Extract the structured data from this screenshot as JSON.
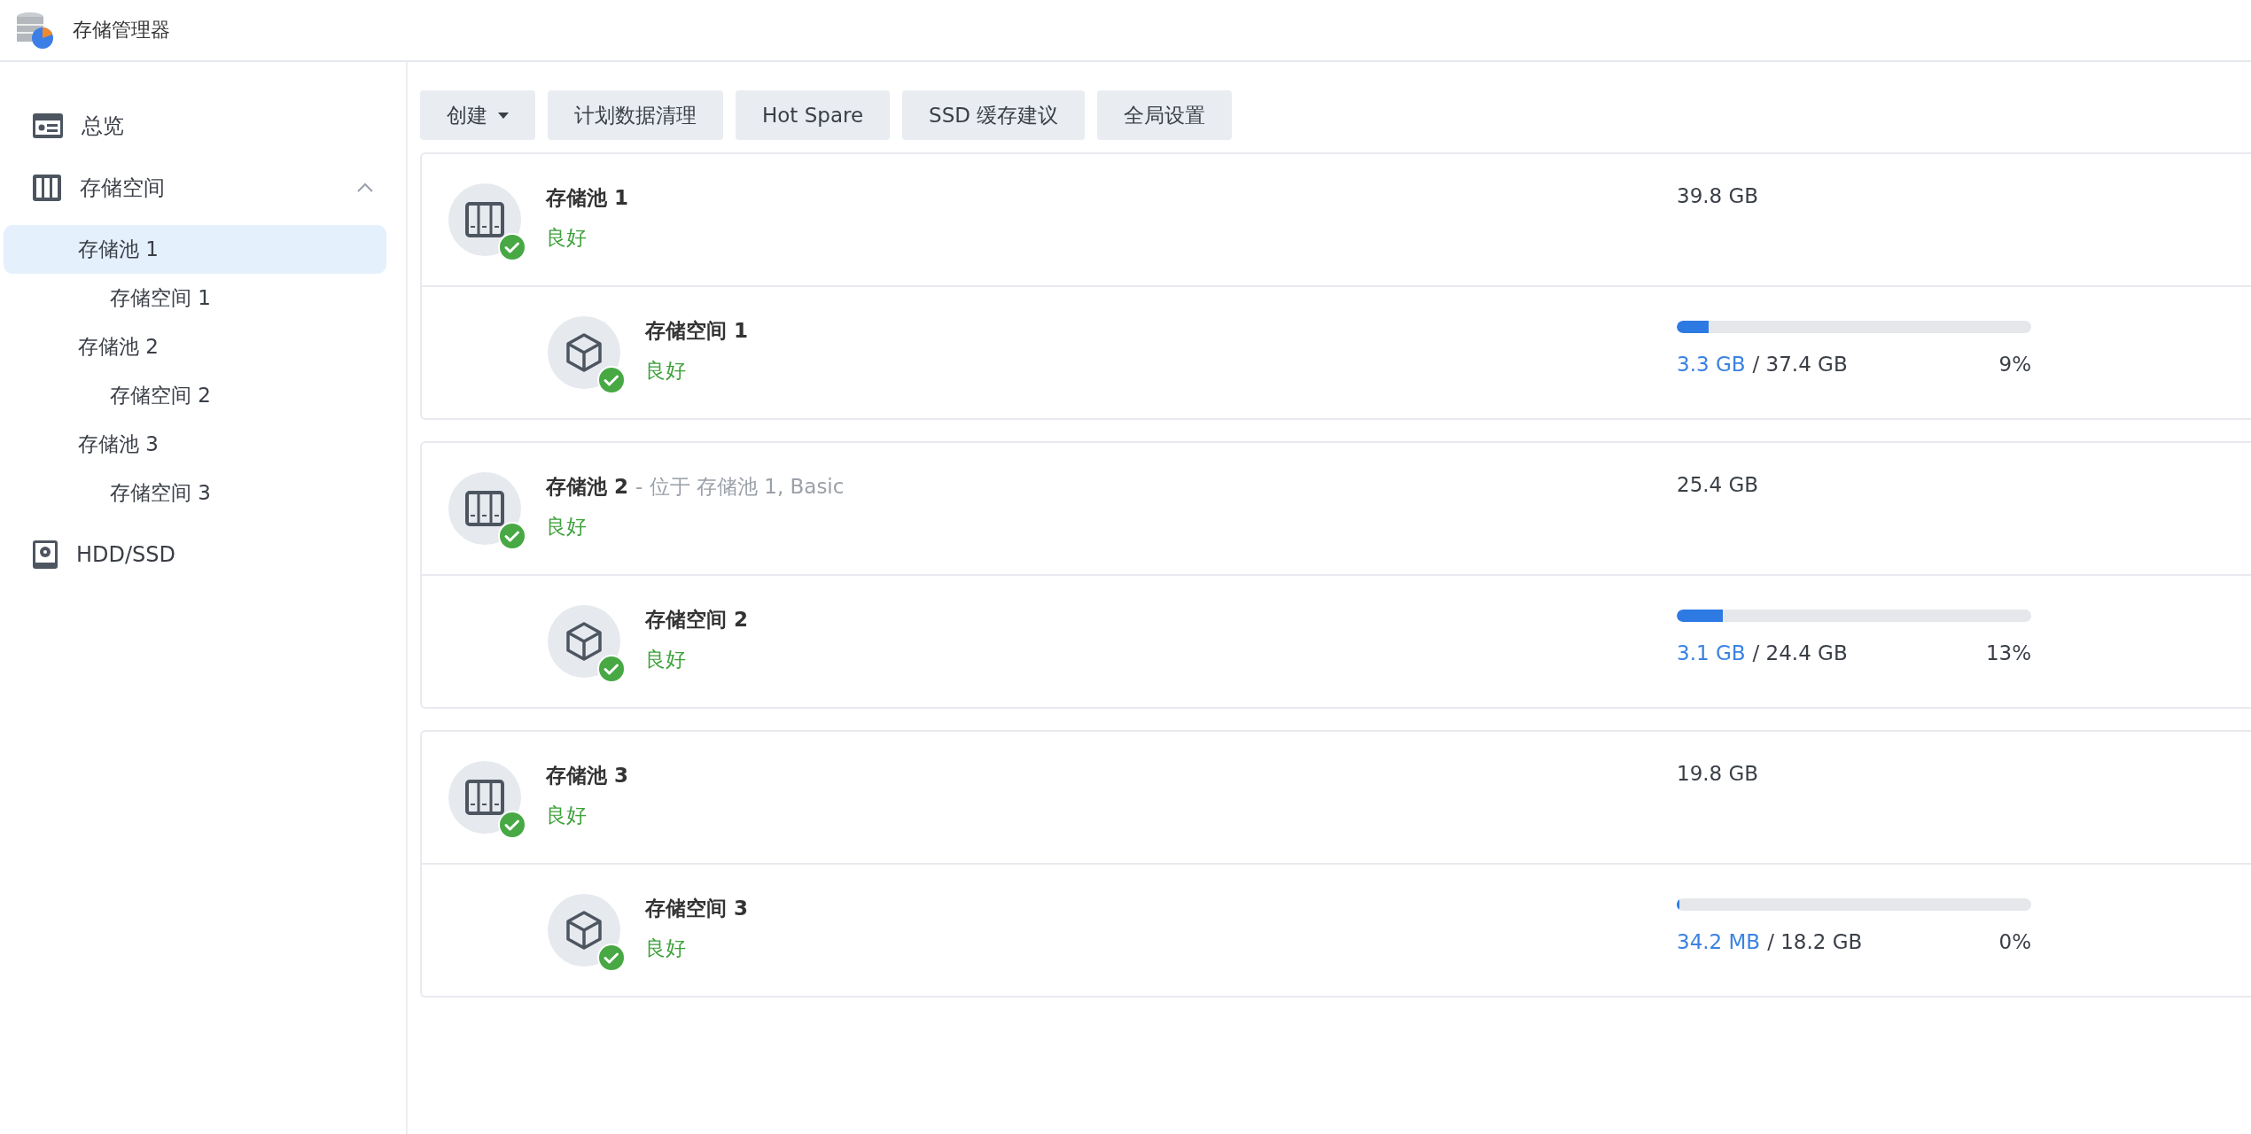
{
  "window": {
    "title": "存储管理器"
  },
  "sidebar": {
    "items": [
      {
        "label": "总览",
        "kind": "overview",
        "selected": false
      },
      {
        "label": "存储空间",
        "kind": "storage",
        "selected": false,
        "expanded": true,
        "children": [
          {
            "label": "存储池 1",
            "selected": true,
            "children": [
              {
                "label": "存储空间 1",
                "selected": false
              }
            ]
          },
          {
            "label": "存储池 2",
            "selected": false,
            "children": [
              {
                "label": "存储空间 2",
                "selected": false
              }
            ]
          },
          {
            "label": "存储池 3",
            "selected": false,
            "children": [
              {
                "label": "存储空间 3",
                "selected": false
              }
            ]
          }
        ]
      },
      {
        "label": "HDD/SSD",
        "kind": "disk",
        "selected": false
      }
    ]
  },
  "toolbar": [
    {
      "label": "创建",
      "dropdown": true
    },
    {
      "label": "计划数据清理",
      "dropdown": false
    },
    {
      "label": "Hot Spare",
      "dropdown": false
    },
    {
      "label": "SSD 缓存建议",
      "dropdown": false
    },
    {
      "label": "全局设置",
      "dropdown": false
    }
  ],
  "pools": [
    {
      "name": "存储池 1",
      "status": "良好",
      "size": "39.8 GB",
      "volume": {
        "name": "存储空间 1",
        "status": "良好",
        "level": 0.09,
        "used": "3.3 GB",
        "total": "/ 37.4 GB",
        "percent": "9%"
      }
    },
    {
      "name": "存储池 2",
      "location": "- 位于 存储池 1, Basic",
      "status": "良好",
      "size": "25.4 GB",
      "volume": {
        "name": "存储空间 2",
        "status": "良好",
        "level": 0.13,
        "used": "3.1 GB",
        "total": "/ 24.4 GB",
        "percent": "13%"
      }
    },
    {
      "name": "存储池 3",
      "status": "良好",
      "size": "19.8 GB",
      "volume": {
        "name": "存储空间 3",
        "status": "良好",
        "level": 0.002,
        "used": "34.2 MB",
        "total": "/ 18.2 GB",
        "percent": "0%"
      }
    }
  ]
}
